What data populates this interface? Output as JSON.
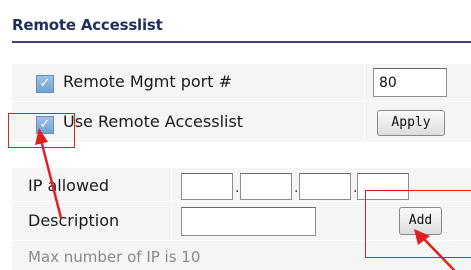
{
  "section": {
    "title": "Remote Accesslist"
  },
  "mgmt_port": {
    "label": "Remote Mgmt port #",
    "value": "80",
    "checked": true
  },
  "use_accesslist": {
    "label": "Use Remote Accesslist",
    "checked": true
  },
  "apply_button": {
    "label": "Apply"
  },
  "ip_allowed": {
    "label": "IP allowed",
    "octets": [
      "",
      "",
      "",
      ""
    ],
    "separator": "."
  },
  "description": {
    "label": "Description",
    "value": ""
  },
  "add_button": {
    "label": "Add"
  },
  "hint": {
    "text": "Max number of IP is 10"
  },
  "annotation_color": "#e02020"
}
